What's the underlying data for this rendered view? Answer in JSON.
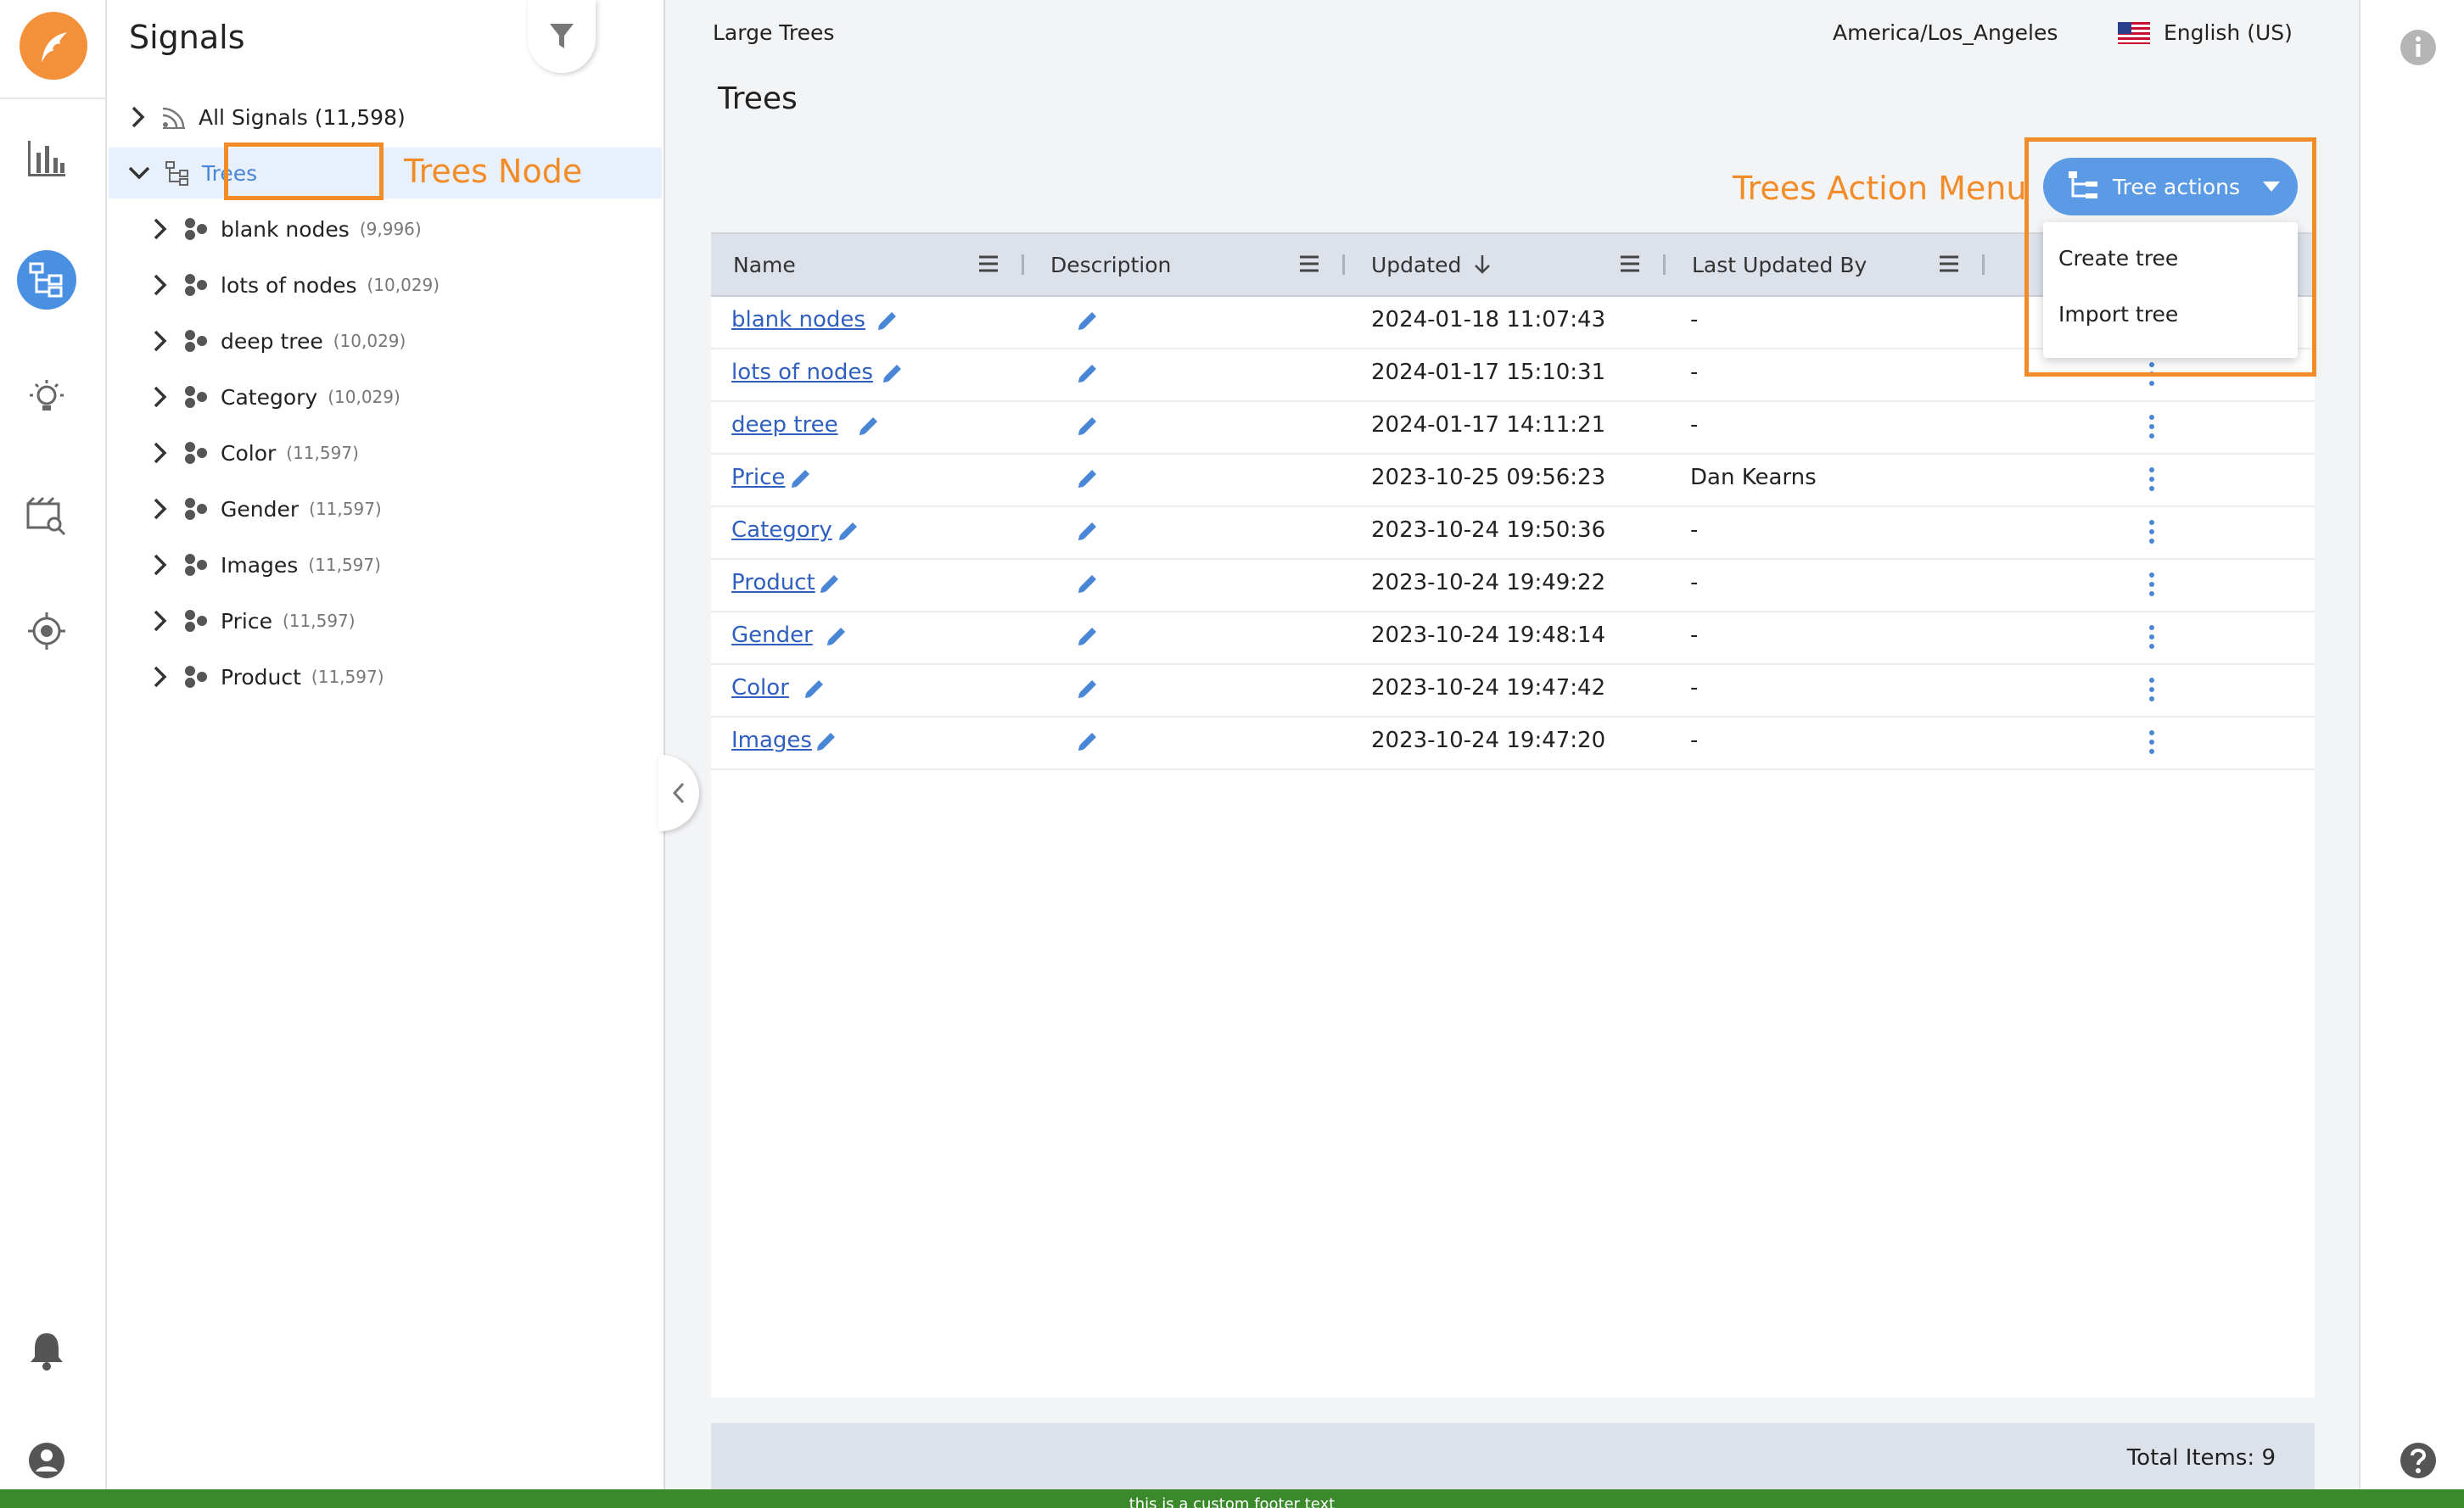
{
  "signals_panel": {
    "title": "Signals",
    "all_signals": {
      "label": "All Signals",
      "count": "(11,598)"
    },
    "trees_node": {
      "label": "Trees"
    },
    "trees_annotation": "Trees Node",
    "children": [
      {
        "label": "blank nodes",
        "count": "(9,996)"
      },
      {
        "label": "lots of nodes",
        "count": "(10,029)"
      },
      {
        "label": "deep tree",
        "count": "(10,029)"
      },
      {
        "label": "Category",
        "count": "(10,029)"
      },
      {
        "label": "Color",
        "count": "(11,597)"
      },
      {
        "label": "Gender",
        "count": "(11,597)"
      },
      {
        "label": "Images",
        "count": "(11,597)"
      },
      {
        "label": "Price",
        "count": "(11,597)"
      },
      {
        "label": "Product",
        "count": "(11,597)"
      }
    ]
  },
  "topbar": {
    "breadcrumb": "Large Trees",
    "timezone": "America/Los_Angeles",
    "language": "English (US)"
  },
  "page": {
    "title": "Trees",
    "actions_annotation": "Trees Action Menu",
    "tree_actions_label": "Tree actions",
    "menu": {
      "create": "Create tree",
      "import": "Import tree"
    }
  },
  "grid": {
    "columns": {
      "name": "Name",
      "description": "Description",
      "updated": "Updated",
      "last_updated_by": "Last Updated By"
    },
    "rows": [
      {
        "name": "blank nodes",
        "updated": "2024-01-18 11:07:43",
        "by": "-"
      },
      {
        "name": "lots of nodes",
        "updated": "2024-01-17 15:10:31",
        "by": "-"
      },
      {
        "name": "deep tree",
        "updated": "2024-01-17 14:11:21",
        "by": "-"
      },
      {
        "name": "Price",
        "updated": "2023-10-25 09:56:23",
        "by": "Dan Kearns"
      },
      {
        "name": "Category",
        "updated": "2023-10-24 19:50:36",
        "by": "-"
      },
      {
        "name": "Product",
        "updated": "2023-10-24 19:49:22",
        "by": "-"
      },
      {
        "name": "Gender",
        "updated": "2023-10-24 19:48:14",
        "by": "-"
      },
      {
        "name": "Color",
        "updated": "2023-10-24 19:47:42",
        "by": "-"
      },
      {
        "name": "Images",
        "updated": "2023-10-24 19:47:20",
        "by": "-"
      }
    ],
    "total": "Total Items: 9"
  },
  "footer_text": "this is a custom footer text",
  "colors": {
    "accent": "#4a90e2",
    "annotation": "#f28c28",
    "brand": "#f2913a",
    "footer": "#3a8a2c"
  }
}
